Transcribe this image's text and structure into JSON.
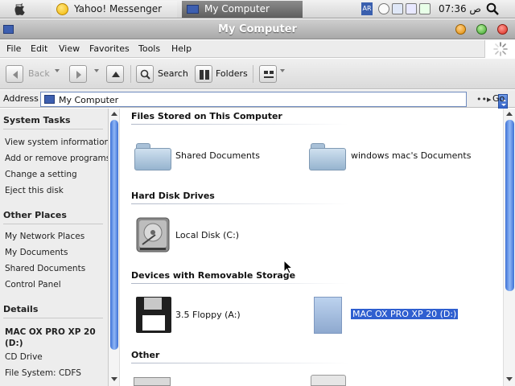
{
  "taskbar": {
    "apple_icon": "apple-logo",
    "tasks": [
      {
        "label": "Yahoo! Messenger",
        "icon": "yahoo-messenger-icon"
      },
      {
        "label": "My Computer",
        "icon": "my-computer-icon",
        "active": true
      }
    ],
    "tray_language": "AR",
    "clock": "07:36 ص"
  },
  "window": {
    "title": "My Computer",
    "menu": [
      "File",
      "Edit",
      "View",
      "Favorites",
      "Tools",
      "Help"
    ]
  },
  "toolbar": {
    "back_label": "Back",
    "search_label": "Search",
    "folders_label": "Folders"
  },
  "address": {
    "label": "Address",
    "value": "My Computer",
    "go_label": "Go"
  },
  "taskpane": {
    "system_tasks": {
      "title": "System Tasks",
      "links": [
        "View system information",
        "Add or remove programs",
        "Change a setting",
        "Eject this disk"
      ]
    },
    "other_places": {
      "title": "Other Places",
      "links": [
        "My Network Places",
        "My Documents",
        "Shared Documents",
        "Control Panel"
      ]
    },
    "details": {
      "title": "Details",
      "name": "MAC OX PRO XP 20 (D:)",
      "lines": [
        "CD Drive",
        "File System: CDFS"
      ]
    }
  },
  "content": {
    "groups": [
      {
        "title": "Files Stored on This Computer",
        "items": [
          "Shared Documents",
          "windows mac's Documents"
        ]
      },
      {
        "title": "Hard Disk Drives",
        "items": [
          "Local Disk (C:)"
        ]
      },
      {
        "title": "Devices with Removable Storage",
        "items": [
          "3.5 Floppy (A:)",
          "MAC OX PRO XP 20 (D:)"
        ]
      },
      {
        "title": "Other",
        "items": []
      }
    ],
    "selected_item": "MAC OX PRO XP 20 (D:)"
  },
  "colors": {
    "selection": "#2f5fd0",
    "scroll_thumb": "#3e72d6",
    "close_button": "#d8281b",
    "minimize_button": "#e08a00",
    "zoom_button": "#3aa22a"
  }
}
